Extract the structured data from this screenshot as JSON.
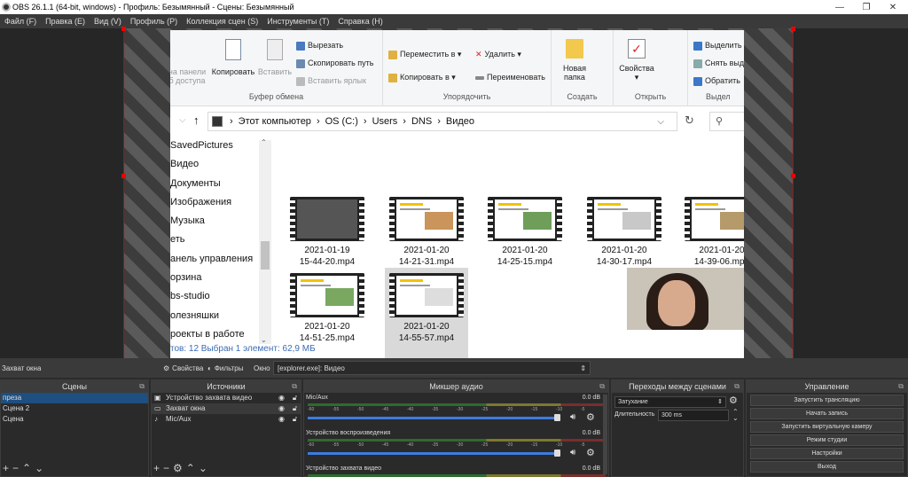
{
  "window": {
    "title": "OBS 26.1.1 (64-bit, windows) - Профиль: Безымянный - Сцены: Безымянный",
    "min": "—",
    "max": "❐",
    "close": "✕"
  },
  "menu": [
    "Файл (F)",
    "Правка (E)",
    "Вид (V)",
    "Профиль (P)",
    "Коллекция сцен (S)",
    "Инструменты (T)",
    "Справка (H)"
  ],
  "explorer": {
    "ribbon": {
      "clipboard": {
        "group": "Буфер обмена",
        "pin": "на панели\nб доступа",
        "copy": "Копировать",
        "paste": "Вставить",
        "cut": "Вырезать",
        "copy_path": "Скопировать путь",
        "paste_shortcut": "Вставить ярлык"
      },
      "organize": {
        "group": "Упорядочить",
        "move": "Переместить в ▾",
        "copy_to": "Копировать в ▾",
        "delete": "Удалить ▾",
        "rename": "Переименовать"
      },
      "new": {
        "group": "Создать",
        "new_folder": "Новая\nпапка"
      },
      "open": {
        "group": "Открыть",
        "properties": "Свойства\n▾"
      },
      "select": {
        "group": "Выдел",
        "select_all": "Выделить",
        "deselect": "Снять выд",
        "invert": "Обратить"
      }
    },
    "address": [
      "Этот компьютер",
      "OS (C:)",
      "Users",
      "DNS",
      "Видео"
    ],
    "nav": [
      "SavedPictures",
      "Видео",
      "Документы",
      "Изображения",
      "Музыка",
      "еть",
      "анель управления",
      "орзина",
      "bs-studio",
      "олезняшки",
      "роекты в работе"
    ],
    "status": "тов: 12     Выбран 1 элемент: 62,9 МБ",
    "files": [
      {
        "name": "2021-01-19\n15-44-20.mp4",
        "selected": false
      },
      {
        "name": "2021-01-20\n14-21-31.mp4",
        "selected": false
      },
      {
        "name": "2021-01-20\n14-25-15.mp4",
        "selected": false
      },
      {
        "name": "2021-01-20\n14-30-17.mp4",
        "selected": false
      },
      {
        "name": "2021-01-20\n14-39-06.mp4",
        "selected": false
      },
      {
        "name": "2021-01-20\n14-51-25.mp4",
        "selected": false
      },
      {
        "name": "2021-01-20\n14-55-57.mp4",
        "selected": true
      }
    ]
  },
  "source_bar": {
    "source_name": "Захват окна",
    "properties": "Свойства",
    "filters": "Фильтры",
    "window_label": "Окно",
    "window_value": "[explorer.exe]: Видео"
  },
  "docks": {
    "scenes": {
      "title": "Сцены",
      "items": [
        "преза",
        "Сцена 2",
        "Сцена"
      ],
      "selected": 0
    },
    "sources": {
      "title": "Источники",
      "items": [
        "Устройство захвата видео",
        "Захват окна",
        "Mic/Aux"
      ],
      "selected": 1
    },
    "mixer": {
      "title": "Микшер аудио",
      "channels": [
        {
          "name": "Mic/Aux",
          "db": "0.0 dB"
        },
        {
          "name": "Устройство воспроизведения",
          "db": "0.0 dB"
        },
        {
          "name": "Устройство захвата видео",
          "db": "0.0 dB"
        }
      ],
      "ticks": [
        "-60",
        "-55",
        "-50",
        "-45",
        "-40",
        "-35",
        "-30",
        "-25",
        "-20",
        "-15",
        "-10",
        "-5",
        "0"
      ]
    },
    "transitions": {
      "title": "Переходы между сценами",
      "type": "Затухание",
      "duration_label": "Длительность",
      "duration": "300 ms"
    },
    "controls": {
      "title": "Управление",
      "buttons": [
        "Запустить трансляцию",
        "Начать запись",
        "Запустить виртуальную камеру",
        "Режим студии",
        "Настройки",
        "Выход"
      ]
    }
  }
}
